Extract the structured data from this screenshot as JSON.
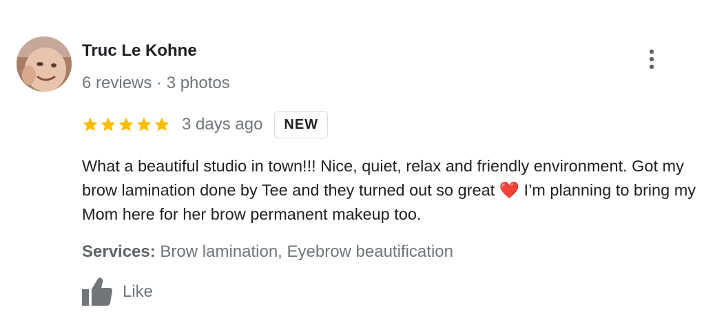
{
  "reviewer": {
    "name": "Truc Le Kohne",
    "meta": "6 reviews · 3 photos"
  },
  "rating": {
    "stars": 5,
    "max_stars": 5,
    "star_color": "#fbbc04"
  },
  "date": "3 days ago",
  "badge": "NEW",
  "review": {
    "part1": "What a beautiful studio in town!!! Nice, quiet, relax and friendly environment. Got my brow lamination done by Tee and they turned out so great ",
    "emoji": "❤️",
    "part2": " I’m planning to bring my Mom here for her brow permanent makeup too."
  },
  "services": {
    "label": "Services:",
    "value": " Brow lamination, Eyebrow beautification"
  },
  "like": {
    "label": "Like"
  },
  "icons": {
    "more": "more-vertical-icon",
    "like": "thumb-up-icon",
    "star": "star-icon"
  }
}
